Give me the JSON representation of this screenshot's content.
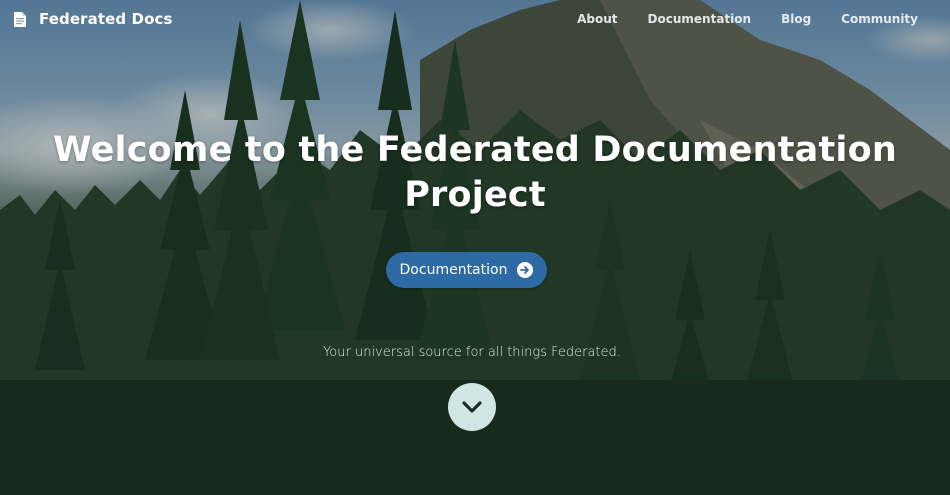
{
  "header": {
    "brand": "Federated Docs",
    "brand_icon": "document-icon",
    "nav": [
      {
        "label": "About"
      },
      {
        "label": "Documentation"
      },
      {
        "label": "Blog"
      },
      {
        "label": "Community"
      }
    ]
  },
  "hero": {
    "title": "Welcome to the Federated Documentation Project",
    "cta_label": "Documentation",
    "cta_icon": "arrow-right-circle-icon",
    "tagline": "Your universal source for all things Federated.",
    "scroll_icon": "chevron-down-icon"
  },
  "colors": {
    "cta_background": "#2e6aa3",
    "scroll_button_background": "#cfe6e3",
    "text": "#ffffff"
  }
}
